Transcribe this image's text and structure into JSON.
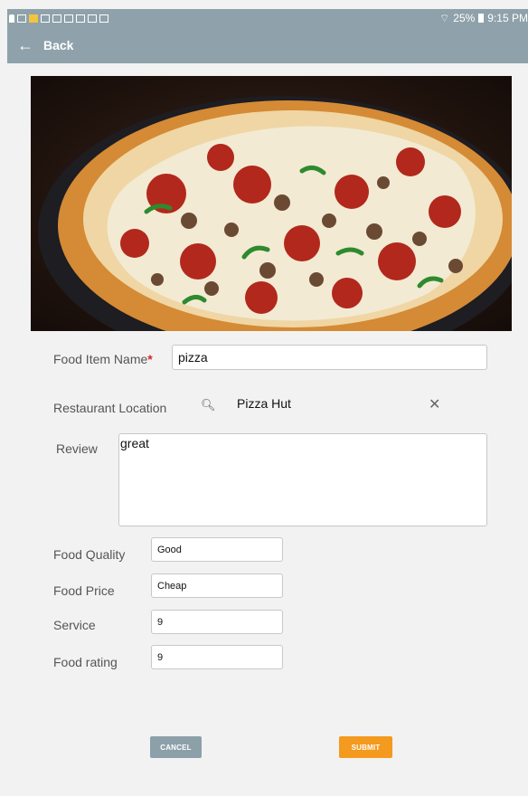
{
  "status_bar": {
    "battery": "25%",
    "time": "9:15 PM"
  },
  "app_bar": {
    "back_label": "Back",
    "back_icon": "arrow-left-icon"
  },
  "hero_image": {
    "subject": "pizza"
  },
  "form": {
    "food_item_name": {
      "label": "Food Item Name",
      "required_mark": "*",
      "value": "pizza"
    },
    "restaurant_location": {
      "label": "Restaurant Location",
      "value": "Pizza Hut",
      "search_icon": "search-icon",
      "clear_icon": "close-icon"
    },
    "review": {
      "label": "Review",
      "value": "great"
    },
    "food_quality": {
      "label": "Food Quality",
      "value": "Good"
    },
    "food_price": {
      "label": "Food Price",
      "value": "Cheap"
    },
    "service": {
      "label": "Service",
      "value": "9"
    },
    "food_rating": {
      "label": "Food rating",
      "value": "9"
    }
  },
  "actions": {
    "cancel_label": "CANCEL",
    "submit_label": "SUBMIT"
  },
  "colors": {
    "app_bar": "#8fa2ab",
    "cancel_button": "#8ca0aa",
    "submit_button": "#f39a1f",
    "required": "#e21f1f"
  }
}
